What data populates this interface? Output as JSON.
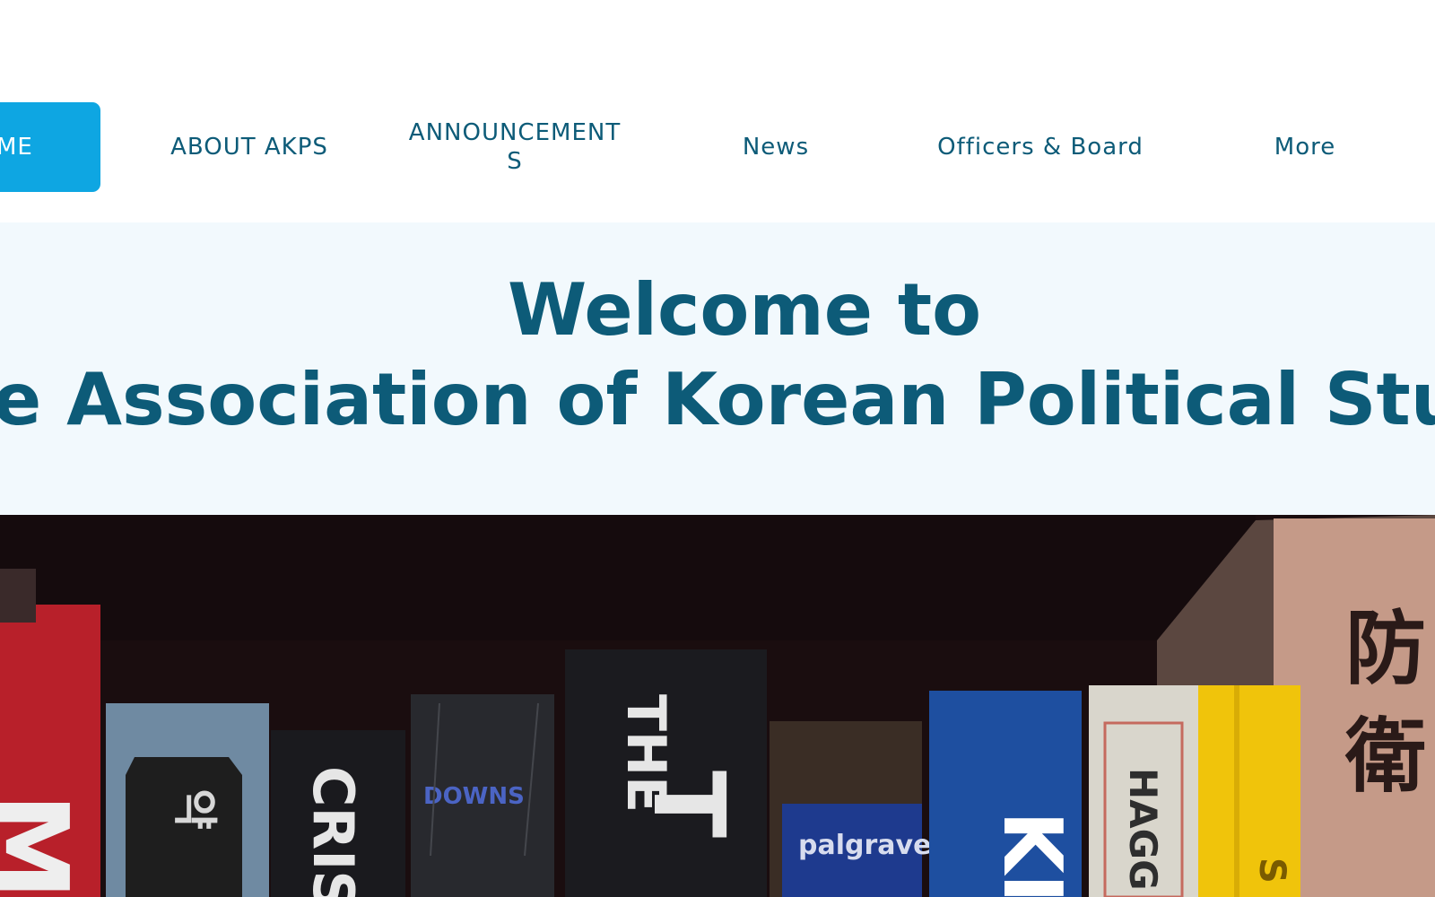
{
  "nav": {
    "items": [
      {
        "label": "ME",
        "active": true
      },
      {
        "label": "ABOUT AKPS"
      },
      {
        "label": "ANNOUNCEMENTS"
      },
      {
        "label": "News"
      },
      {
        "label": "Officers & Board"
      },
      {
        "label": "More"
      }
    ]
  },
  "hero": {
    "line1": "Welcome to",
    "line2": "e Association of Korean Political Studies (A"
  },
  "image": {
    "spines": {
      "downs": "DOWNS",
      "palgrave": "palgrave",
      "cris": "CRIS",
      "the": "THE",
      "hagg": "HAGG",
      "ki": "KI"
    }
  },
  "colors": {
    "accent": "#0ea6e2",
    "text": "#0d5b78",
    "hero_bg": "#f2f9fd"
  }
}
